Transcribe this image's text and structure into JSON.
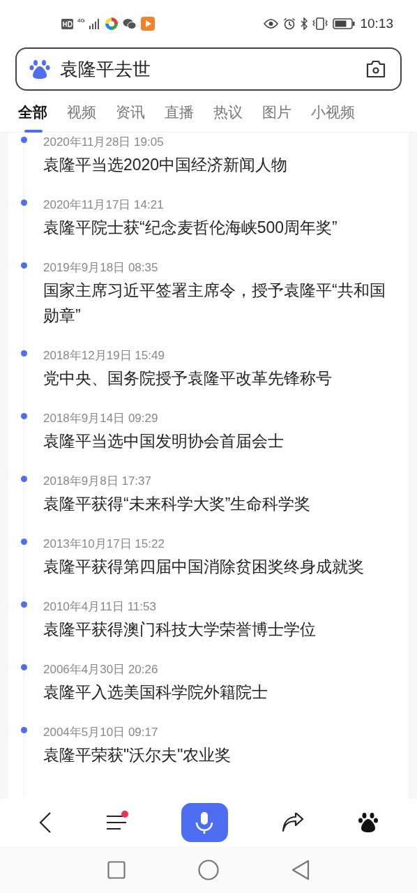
{
  "status_bar": {
    "time": "10:13",
    "network": "4G"
  },
  "search": {
    "value": "袁隆平去世"
  },
  "tabs": [
    {
      "label": "全部",
      "selected": true
    },
    {
      "label": "视频",
      "selected": false
    },
    {
      "label": "资讯",
      "selected": false
    },
    {
      "label": "直播",
      "selected": false
    },
    {
      "label": "热议",
      "selected": false
    },
    {
      "label": "图片",
      "selected": false
    },
    {
      "label": "小视频",
      "selected": false
    }
  ],
  "timeline": [
    {
      "date": "2020年11月28日 19:05",
      "title": "袁隆平当选2020中国经济新闻人物"
    },
    {
      "date": "2020年11月17日 14:21",
      "title": "袁隆平院士获“纪念麦哲伦海峡500周年奖”"
    },
    {
      "date": "2019年9月18日 08:35",
      "title": "国家主席习近平签署主席令，授予袁隆平“共和国勋章”"
    },
    {
      "date": "2018年12月19日 15:49",
      "title": "党中央、国务院授予袁隆平改革先锋称号"
    },
    {
      "date": "2018年9月14日 09:29",
      "title": "袁隆平当选中国发明协会首届会士"
    },
    {
      "date": "2018年9月8日 17:37",
      "title": "袁隆平获得“未来科学大奖”生命科学奖"
    },
    {
      "date": "2013年10月17日 15:22",
      "title": "袁隆平获得第四届中国消除贫困奖终身成就奖"
    },
    {
      "date": "2010年4月11日 11:53",
      "title": "袁隆平获得澳门科技大学荣誉博士学位"
    },
    {
      "date": "2006年4月30日 20:26",
      "title": "袁隆平入选美国科学院外籍院士"
    },
    {
      "date": "2004年5月10日 09:17",
      "title": "袁隆平荣获\"沃尔夫\"农业奖"
    }
  ],
  "toolbar": {
    "menu_badge": true
  }
}
